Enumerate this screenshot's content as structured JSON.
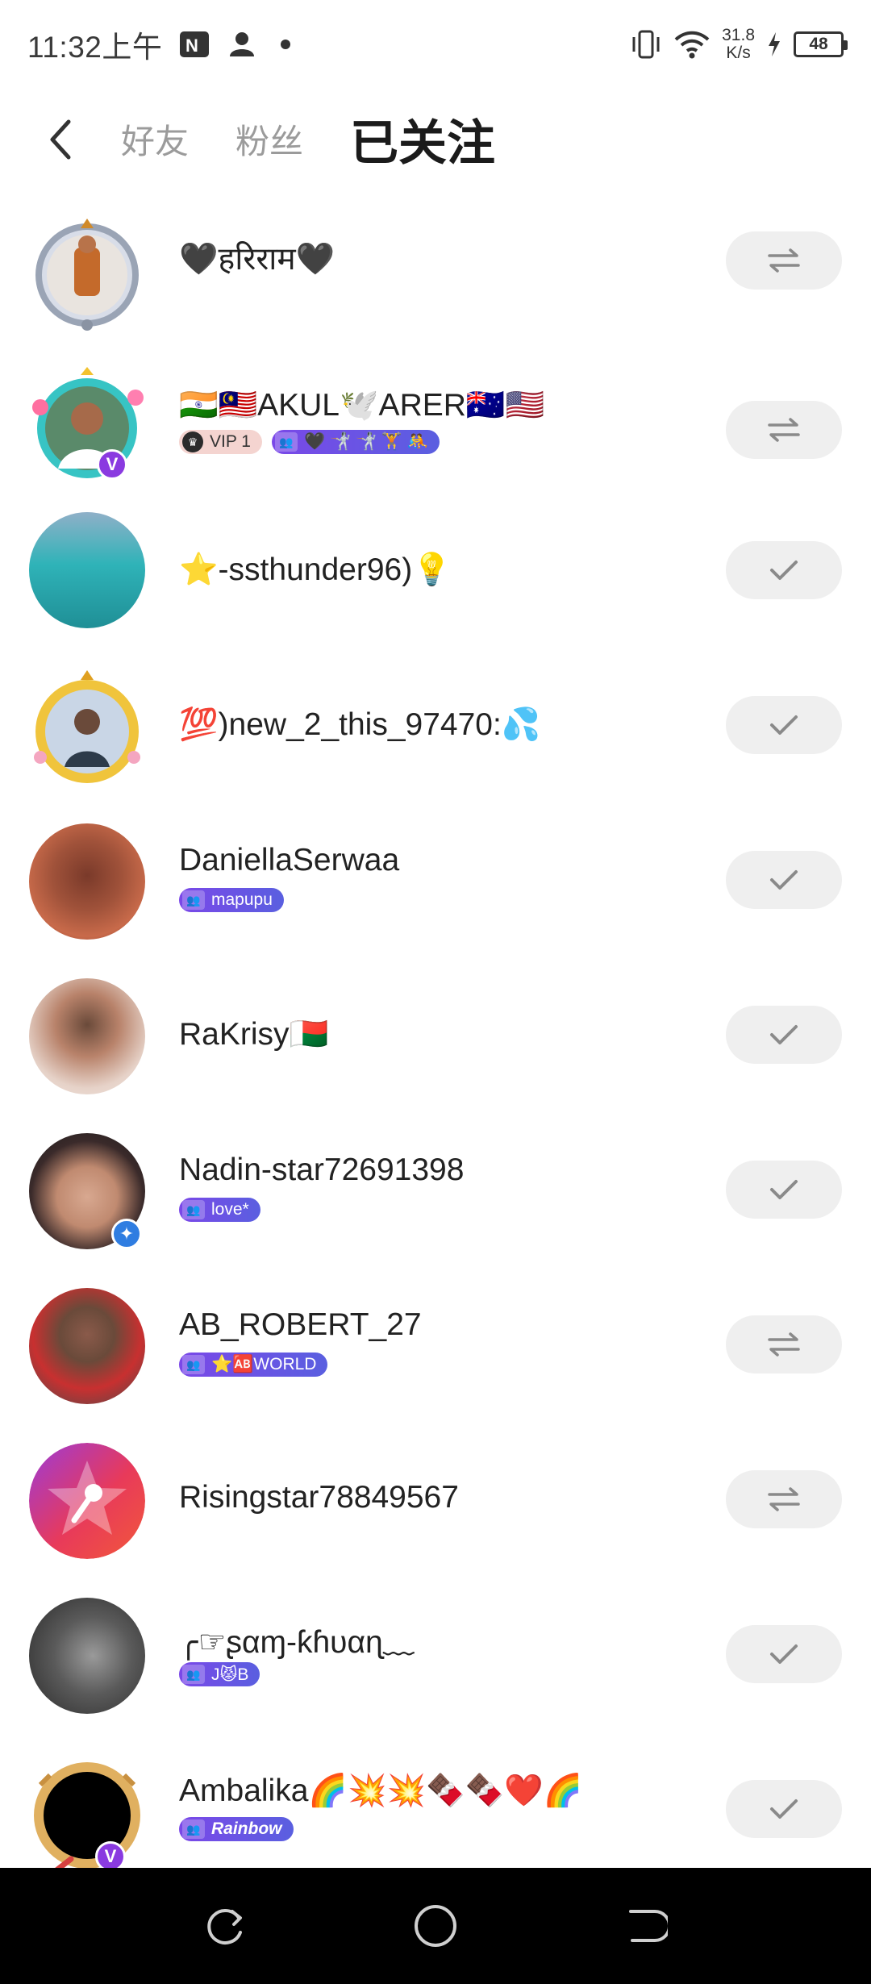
{
  "status_bar": {
    "time": "11:32上午",
    "net_speed_value": "31.8",
    "net_speed_unit": "K/s",
    "battery": "48",
    "icons": [
      "nfc-icon",
      "person-icon",
      "dot-icon",
      "vibrate-icon",
      "wifi-icon",
      "charging-icon",
      "battery-icon"
    ]
  },
  "header": {
    "tabs": [
      {
        "label": "好友",
        "active": false
      },
      {
        "label": "粉丝",
        "active": false
      },
      {
        "label": "已关注",
        "active": true
      }
    ]
  },
  "users": [
    {
      "name": "🖤हरिराम🖤",
      "badges": [],
      "follow_state": "mutual"
    },
    {
      "name": "🇮🇳🇲🇾AKUL🕊️ARER🇦🇺🇺🇸",
      "badges": [
        {
          "type": "vip",
          "text": "VIP 1"
        },
        {
          "type": "fan",
          "text": "🖤 🤺 🤺 🏋 🤼"
        }
      ],
      "follow_state": "mutual"
    },
    {
      "name": "⭐-ssthunder96)💡",
      "badges": [],
      "follow_state": "following"
    },
    {
      "name": "💯)new_2_this_97470:💦",
      "badges": [],
      "follow_state": "following"
    },
    {
      "name": "DaniellaSerwaa",
      "badges": [
        {
          "type": "fan",
          "text": "mapupu"
        }
      ],
      "follow_state": "following"
    },
    {
      "name": "RaKrisy🇲🇬",
      "badges": [],
      "follow_state": "following"
    },
    {
      "name": "Nadin-star72691398",
      "badges": [
        {
          "type": "fan",
          "text": "love*"
        }
      ],
      "follow_state": "following"
    },
    {
      "name": "AB_ROBERT_27",
      "badges": [
        {
          "type": "fan",
          "text": "⭐🆎WORLD"
        }
      ],
      "follow_state": "mutual"
    },
    {
      "name": "Risingstar78849567",
      "badges": [],
      "follow_state": "mutual"
    },
    {
      "name": "╭☞ʂαɱ-ƙɦυαɳ﹏",
      "badges": [
        {
          "type": "fan",
          "text": "J😾B"
        }
      ],
      "follow_state": "following"
    },
    {
      "name": "Ambalika🌈💥💥🍫🍫❤️🌈",
      "badges": [
        {
          "type": "fan",
          "text": "Rainbow"
        }
      ],
      "follow_state": "following"
    }
  ],
  "colors": {
    "accent_purple": "#7a48e8",
    "follow_button_bg": "#efefef",
    "icon_gray": "#8a8a8a"
  },
  "navigation": [
    "recent-apps-icon",
    "home-icon",
    "back-icon"
  ]
}
